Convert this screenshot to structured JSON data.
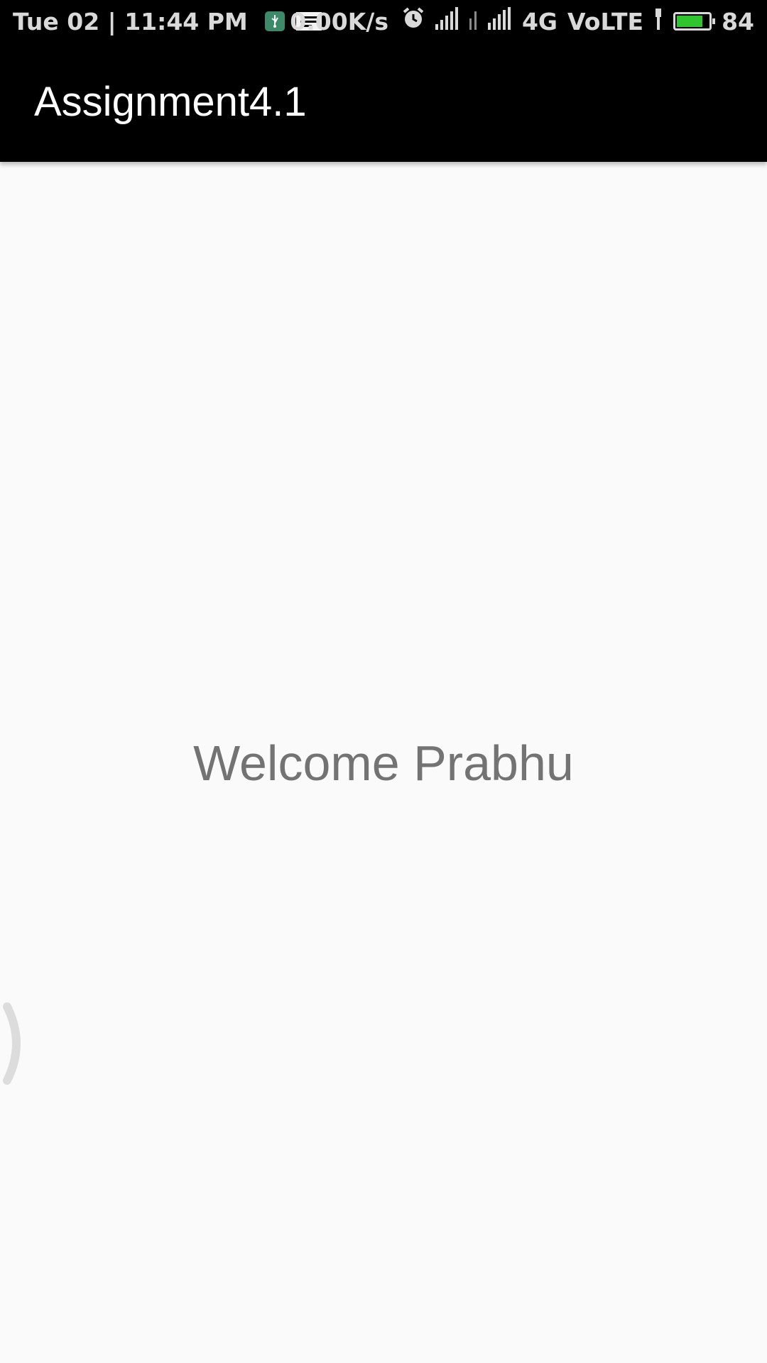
{
  "status_bar": {
    "time": "Tue 02 | 11:44 PM",
    "speed": "0.00K/s",
    "network": "4G",
    "volte": "VoLTE",
    "battery_percent": "84",
    "battery_level": 0.84,
    "battery_color": "#2ec52e",
    "icons": [
      "usb-icon",
      "message-icon",
      "alarm-icon",
      "signal-icon",
      "signal-weak-icon",
      "signal-icon-2",
      "charging-icon",
      "battery-icon"
    ]
  },
  "app_bar": {
    "title": "Assignment4.1",
    "background": "#000000"
  },
  "main": {
    "welcome_text": "Welcome Prabhu",
    "background": "#fafafa"
  }
}
